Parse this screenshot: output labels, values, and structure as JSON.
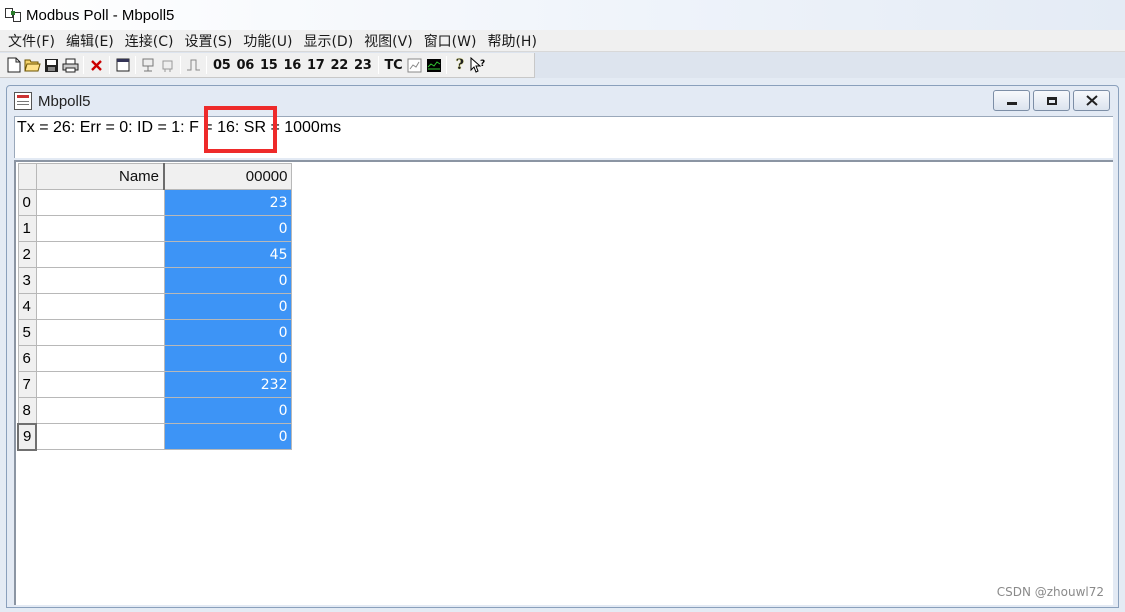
{
  "app": {
    "title": "Modbus Poll - Mbpoll5"
  },
  "menu": {
    "items": [
      "文件(F)",
      "编辑(E)",
      "连接(C)",
      "设置(S)",
      "功能(U)",
      "显示(D)",
      "视图(V)",
      "窗口(W)",
      "帮助(H)"
    ]
  },
  "toolbar": {
    "function_codes": [
      "05",
      "06",
      "15",
      "16",
      "17",
      "22",
      "23"
    ],
    "tc_label": "TC",
    "icons": [
      "new-file-icon",
      "open-folder-icon",
      "save-icon",
      "print-icon",
      "delete-icon",
      "window-icon",
      "connect-icon",
      "disconnect-icon",
      "pulse-icon",
      "chart-icon",
      "monitor-icon",
      "help-icon",
      "context-help-icon"
    ]
  },
  "child_window": {
    "title": "Mbpoll5",
    "status_text": "Tx = 26: Err = 0: ID = 1: F = 16: SR = 1000ms"
  },
  "grid": {
    "name_header": "Name",
    "address_header": "00000",
    "rows": [
      {
        "index": "0",
        "name": "",
        "value": "23"
      },
      {
        "index": "1",
        "name": "",
        "value": "0"
      },
      {
        "index": "2",
        "name": "",
        "value": "45"
      },
      {
        "index": "3",
        "name": "",
        "value": "0"
      },
      {
        "index": "4",
        "name": "",
        "value": "0"
      },
      {
        "index": "5",
        "name": "",
        "value": "0"
      },
      {
        "index": "6",
        "name": "",
        "value": "0"
      },
      {
        "index": "7",
        "name": "",
        "value": "232"
      },
      {
        "index": "8",
        "name": "",
        "value": "0"
      },
      {
        "index": "9",
        "name": "",
        "value": "0"
      }
    ],
    "value_color": "#3d94f6"
  },
  "annotation": {
    "highlight_color": "#ee2a2a"
  },
  "watermark": "CSDN @zhouwl72"
}
